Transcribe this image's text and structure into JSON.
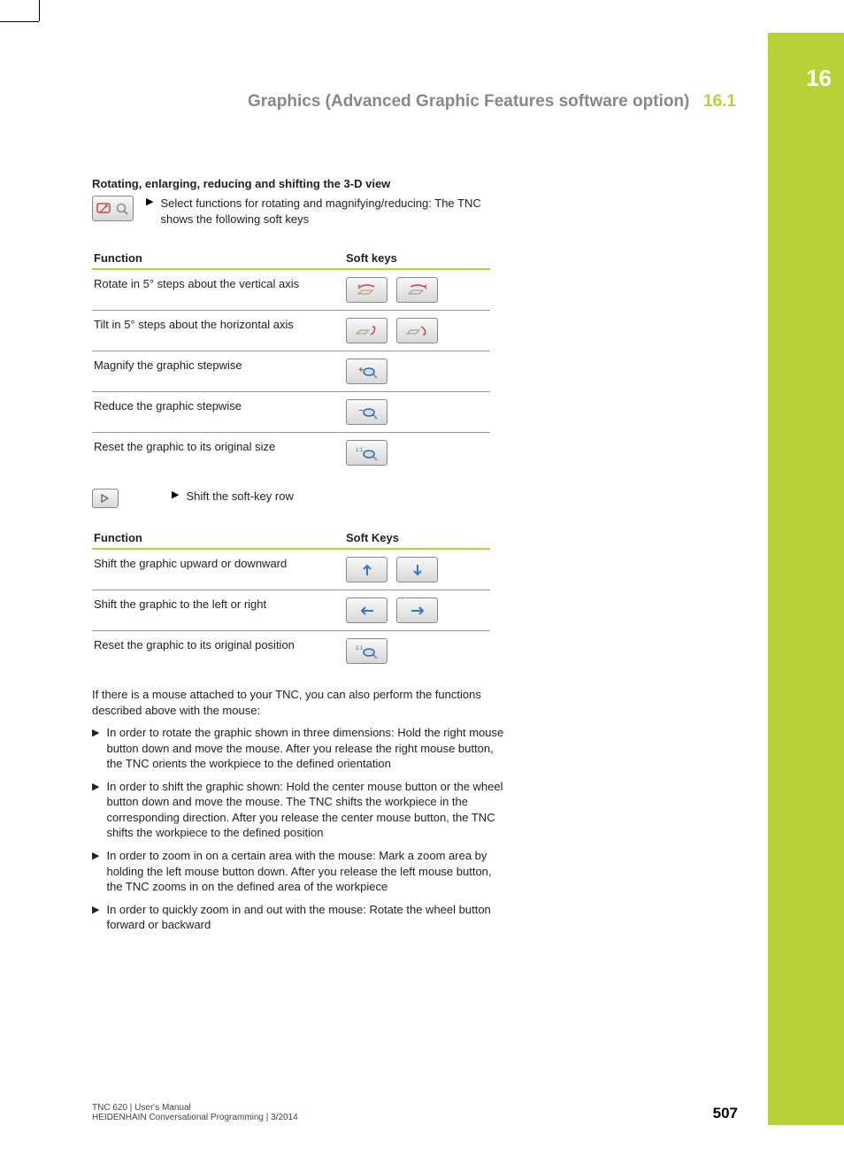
{
  "chapter_number": "16",
  "header": {
    "title": "Graphics (Advanced Graphic Features software option)",
    "section": "16.1"
  },
  "sub_heading": "Rotating, enlarging, reducing and shifting the 3-D view",
  "intro_bullet": "Select functions for rotating and magnifying/reducing: The TNC shows the following soft keys",
  "table1": {
    "head_function": "Function",
    "head_keys": "Soft keys",
    "rows": [
      {
        "fn": "Rotate in 5° steps about the vertical axis"
      },
      {
        "fn": "Tilt in 5° steps about the horizontal axis"
      },
      {
        "fn": "Magnify the graphic stepwise"
      },
      {
        "fn": "Reduce the graphic stepwise"
      },
      {
        "fn": "Reset the graphic to its original size"
      }
    ]
  },
  "shift_bullet": "Shift the soft-key row",
  "table2": {
    "head_function": "Function",
    "head_keys": "Soft Keys",
    "rows": [
      {
        "fn": "Shift the graphic upward or downward"
      },
      {
        "fn": "Shift the graphic to the left or right"
      },
      {
        "fn": "Reset the graphic to its original position"
      }
    ]
  },
  "mouse_intro": "If there is a mouse attached to your TNC, you can also perform the functions described above with the mouse:",
  "mouse_list": [
    "In order to rotate the graphic shown in three dimensions: Hold the right mouse button down and move the mouse. After you release the right mouse button, the TNC orients the workpiece to the defined orientation",
    "In order to shift the graphic shown: Hold the center mouse button or the wheel button down and move the mouse. The TNC shifts the workpiece in the corresponding direction. After you release the center mouse button, the TNC shifts the workpiece to the defined position",
    "In order to zoom in on a certain area with the mouse: Mark a zoom area by holding the left mouse button down. After you release the left mouse button, the TNC zooms in on the defined area of the workpiece",
    "In order to quickly zoom in and out with the mouse: Rotate the wheel button forward or backward"
  ],
  "footer": {
    "line1": "TNC 620 | User's Manual",
    "line2": "HEIDENHAIN Conversational Programming | 3/2014",
    "page": "507"
  },
  "icons": {
    "rotate_magnify": "rotate-magnify-icon",
    "next": "next-icon"
  }
}
